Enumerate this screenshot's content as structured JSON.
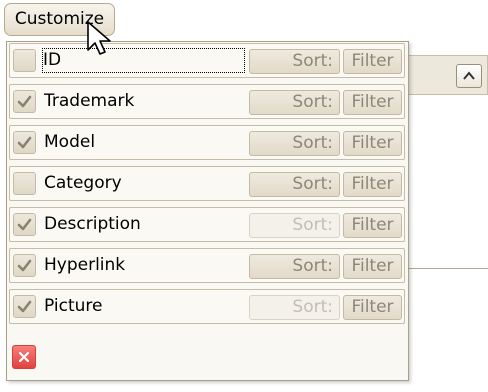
{
  "customize_button": {
    "label": "Customize"
  },
  "fields": [
    {
      "label": "ID",
      "checked": false,
      "sort_enabled": true,
      "focused": true
    },
    {
      "label": "Trademark",
      "checked": true,
      "sort_enabled": true,
      "focused": false
    },
    {
      "label": "Model",
      "checked": true,
      "sort_enabled": true,
      "focused": false
    },
    {
      "label": "Category",
      "checked": false,
      "sort_enabled": true,
      "focused": false
    },
    {
      "label": "Description",
      "checked": true,
      "sort_enabled": false,
      "focused": false
    },
    {
      "label": "Hyperlink",
      "checked": true,
      "sort_enabled": true,
      "focused": false
    },
    {
      "label": "Picture",
      "checked": true,
      "sort_enabled": false,
      "focused": false
    }
  ],
  "buttons": {
    "sort_label": "Sort:",
    "filter_label": "Filter"
  },
  "icons": {
    "check": "check-icon",
    "close": "close-icon",
    "cursor": "arrow-cursor-icon",
    "scroll_up": "chevron-up-icon"
  },
  "colors": {
    "checkmark": "#8a8270",
    "close_button": "#e0433f",
    "popup_background": "#f9f8f3",
    "button_text": "#8d8777"
  }
}
